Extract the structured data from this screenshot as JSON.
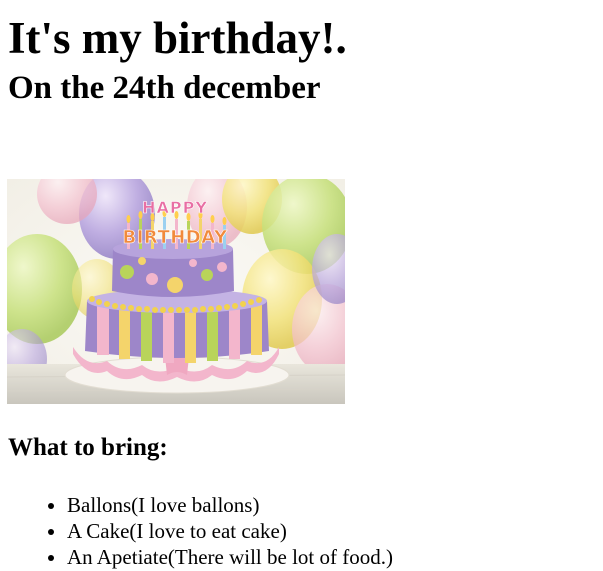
{
  "page": {
    "title": "It's my birthday!.",
    "subtitle": "On the 24th december",
    "image": {
      "name": "birthday-cake-image",
      "topper_text": "HAPPY BIRTHDAY"
    },
    "bring_heading": "What to bring:",
    "bring_items": [
      "Ballons(I love ballons)",
      "A Cake(I love to eat cake)",
      "An Apetiate(There will be lot of food.)"
    ]
  },
  "colors": {
    "cake_purple": "#9d86c9",
    "cake_pink": "#f3b6cc",
    "cake_yellow": "#f4d46b",
    "cake_green": "#b9d45a",
    "balloon_green": "#c6e07a",
    "balloon_purple": "#b9a6e0",
    "balloon_yellow": "#f2e27a"
  }
}
